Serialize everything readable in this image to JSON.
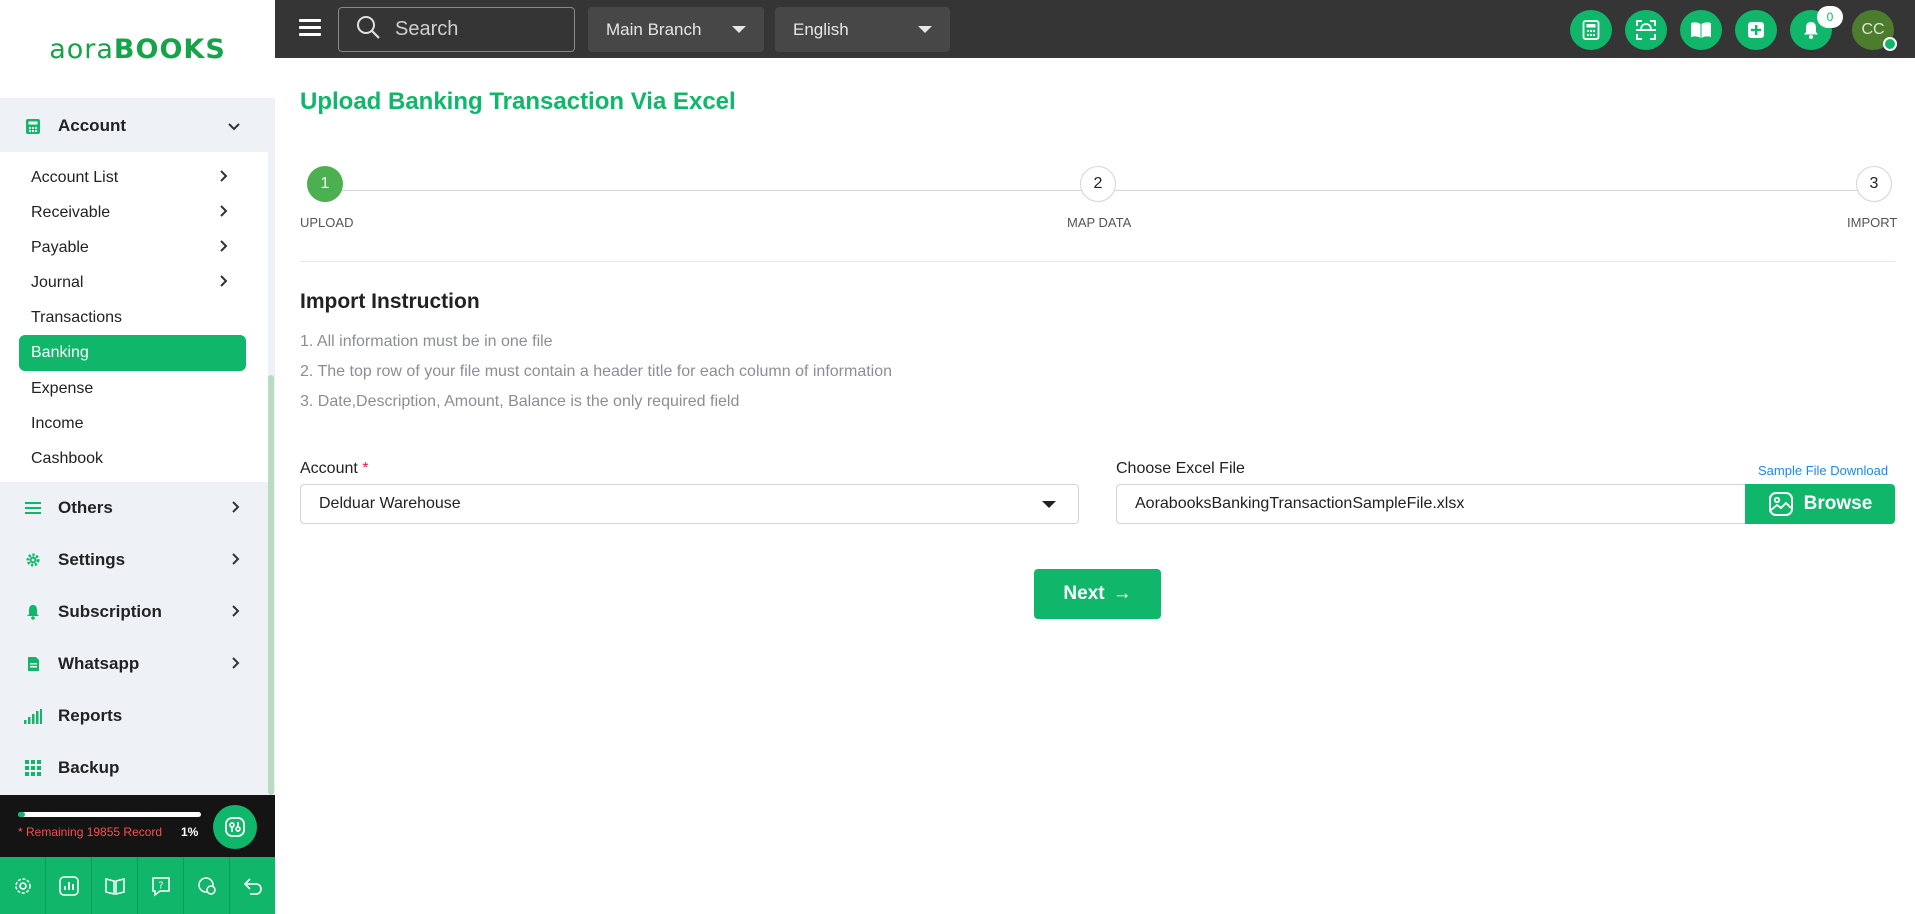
{
  "app": {
    "logo_text_light": "aora",
    "logo_text_bold": "BOOKS"
  },
  "topbar": {
    "search_placeholder": "Search",
    "branch": "Main Branch",
    "language": "English",
    "notification_count": "0",
    "avatar_initials": "CC",
    "icons": [
      "calculator-icon",
      "scan-icon",
      "book-open-icon",
      "plus-square-icon",
      "bell-icon"
    ]
  },
  "sidebar": {
    "account": {
      "label": "Account",
      "items": [
        {
          "label": "Account List",
          "has_children": true
        },
        {
          "label": "Receivable",
          "has_children": true
        },
        {
          "label": "Payable",
          "has_children": true
        },
        {
          "label": "Journal",
          "has_children": true
        },
        {
          "label": "Transactions",
          "has_children": false
        },
        {
          "label": "Banking",
          "has_children": false,
          "active": true
        },
        {
          "label": "Expense",
          "has_children": false
        },
        {
          "label": "Income",
          "has_children": false
        },
        {
          "label": "Cashbook",
          "has_children": false
        }
      ]
    },
    "sections": [
      {
        "label": "Others",
        "icon": "list-icon"
      },
      {
        "label": "Settings",
        "icon": "gear-icon"
      },
      {
        "label": "Subscription",
        "icon": "bell-icon"
      },
      {
        "label": "Whatsapp",
        "icon": "document-icon"
      },
      {
        "label": "Reports",
        "icon": "signal-bars-icon"
      },
      {
        "label": "Backup",
        "icon": "grid-icon"
      }
    ],
    "usage": {
      "remaining_text": "* Remaining 19855 Record",
      "percent_text": "1%",
      "percent": 1
    },
    "bottom_icons": [
      "settings-icon",
      "chart-icon",
      "book-icon",
      "help-icon",
      "chat-icon",
      "back-icon"
    ]
  },
  "page": {
    "title": "Upload Banking Transaction Via Excel",
    "steps": [
      {
        "number": "1",
        "label": "UPLOAD",
        "done": true
      },
      {
        "number": "2",
        "label": "MAP DATA",
        "done": false
      },
      {
        "number": "3",
        "label": "IMPORT",
        "done": false
      }
    ],
    "instructions_title": "Import Instruction",
    "instructions": [
      "1. All information must be in one file",
      "2. The top row of your file must contain a header title for each column of information",
      "3. Date,Description, Amount, Balance is the only required field"
    ],
    "account_label": "Account",
    "required_mark": "*",
    "account_value": "Delduar Warehouse",
    "file_label": "Choose Excel File",
    "sample_link": "Sample File Download",
    "file_value": "AorabooksBankingTransactionSampleFile.xlsx",
    "browse_label": "Browse",
    "next_label": "Next",
    "next_arrow": "→"
  },
  "colors": {
    "accent": "#10b76a",
    "topbar": "#353535",
    "sidebar_bg": "#eef2f7"
  }
}
